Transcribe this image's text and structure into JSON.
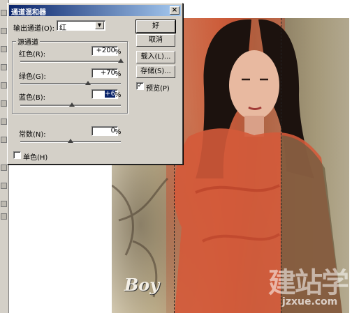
{
  "dialog": {
    "title": "通道混和器",
    "close": "×",
    "output_channel_label": "输出通道(O):",
    "output_channel_value": "红",
    "source_group_title": "源通道",
    "sliders": [
      {
        "label": "红色(R):",
        "value": "+200",
        "unit": "%",
        "level_percent": 200
      },
      {
        "label": "绿色(G):",
        "value": "+70",
        "unit": "%",
        "level_percent": 70
      },
      {
        "label": "蓝色(B):",
        "value": "+6",
        "unit": "%",
        "level_percent": 6
      }
    ],
    "constant": {
      "label": "常数(N):",
      "value": "0",
      "unit": "%",
      "level_percent": 0
    },
    "monochrome": {
      "label": "单色(H)",
      "checked": false
    },
    "buttons": {
      "ok": "好",
      "cancel": "取消",
      "load": "载入(L)...",
      "save": "存储(S)..."
    },
    "preview": {
      "label": "预览(P)",
      "checked": true,
      "mark": "✓"
    }
  },
  "canvas": {
    "logo_text": "Boy",
    "watermark_cn": "建站学",
    "watermark_url": "jzxue.com"
  },
  "colors": {
    "titlebar_start": "#0a246a",
    "titlebar_end": "#a6caf0",
    "dialog_face": "#d4d0c8"
  }
}
